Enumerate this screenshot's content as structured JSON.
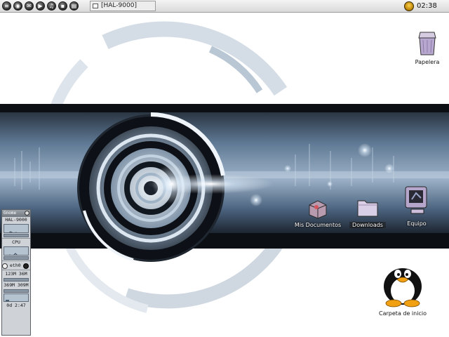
{
  "panel": {
    "launchers": [
      {
        "icon": "app-menu-icon",
        "glyph": "≡"
      },
      {
        "icon": "browser-icon",
        "glyph": "◉"
      },
      {
        "icon": "mail-icon",
        "glyph": "✉"
      },
      {
        "icon": "media-player-icon",
        "glyph": "▶"
      },
      {
        "icon": "music-icon",
        "glyph": "♫"
      },
      {
        "icon": "terminal-icon",
        "glyph": "▪"
      },
      {
        "icon": "office-icon",
        "glyph": "▤"
      }
    ],
    "taskbar_window": "[HAL-9000]",
    "clock": "02:38"
  },
  "desktop_icons": {
    "papelera": "Papelera",
    "mis_documentos": "Mis Documentos",
    "downloads": "Downloads",
    "equipo": "Equipo",
    "carpeta_inicio": "Carpeta de inicio"
  },
  "gkrellm": {
    "title": "Gnome",
    "hostname": "HAL-9000",
    "cpu_label": "CPU",
    "net_label": "eth0",
    "mem_line1": "123M 36M",
    "mem_line2": "369M 309M",
    "uptime": "0d  2:47"
  },
  "colors": {
    "panel": "#e4e4e4",
    "wallpaper_dark": "#0c0f14",
    "wallpaper_blue": "#6f8aa6",
    "gkrellm_bg": "#cfd3d8"
  }
}
